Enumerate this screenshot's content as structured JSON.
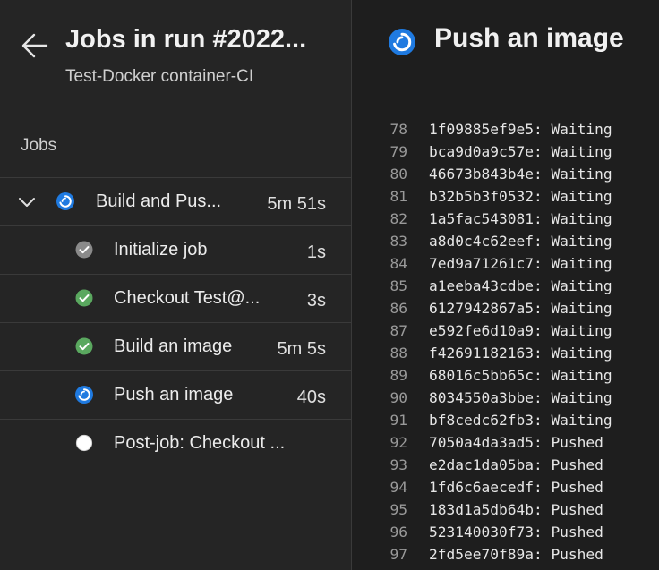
{
  "header": {
    "title": "Jobs in run #2022...",
    "subtitle": "Test-Docker container-CI"
  },
  "sidebar": {
    "section_label": "Jobs",
    "jobs": [
      {
        "name": "Build and Pus...",
        "duration": "5m 51s",
        "status": "running",
        "level": "parent"
      },
      {
        "name": "Initialize job",
        "duration": "1s",
        "status": "succeeded-gray",
        "level": "child"
      },
      {
        "name": "Checkout Test@...",
        "duration": "3s",
        "status": "succeeded",
        "level": "child"
      },
      {
        "name": "Build an image",
        "duration": "5m 5s",
        "status": "succeeded",
        "level": "child"
      },
      {
        "name": "Push an image",
        "duration": "40s",
        "status": "running",
        "level": "child"
      },
      {
        "name": "Post-job: Checkout ...",
        "duration": "",
        "status": "pending",
        "level": "child"
      }
    ]
  },
  "detail": {
    "title": "Push an image",
    "status": "running",
    "log": [
      {
        "no": "78",
        "text": "1f09885ef9e5: Waiting"
      },
      {
        "no": "79",
        "text": "bca9d0a9c57e: Waiting"
      },
      {
        "no": "80",
        "text": "46673b843b4e: Waiting"
      },
      {
        "no": "81",
        "text": "b32b5b3f0532: Waiting"
      },
      {
        "no": "82",
        "text": "1a5fac543081: Waiting"
      },
      {
        "no": "83",
        "text": "a8d0c4c62eef: Waiting"
      },
      {
        "no": "84",
        "text": "7ed9a71261c7: Waiting"
      },
      {
        "no": "85",
        "text": "a1eeba43cdbe: Waiting"
      },
      {
        "no": "86",
        "text": "6127942867a5: Waiting"
      },
      {
        "no": "87",
        "text": "e592fe6d10a9: Waiting"
      },
      {
        "no": "88",
        "text": "f42691182163: Waiting"
      },
      {
        "no": "89",
        "text": "68016c5bb65c: Waiting"
      },
      {
        "no": "90",
        "text": "8034550a3bbe: Waiting"
      },
      {
        "no": "91",
        "text": "bf8cedc62fb3: Waiting"
      },
      {
        "no": "92",
        "text": "7050a4da3ad5: Pushed"
      },
      {
        "no": "93",
        "text": "e2dac1da05ba: Pushed"
      },
      {
        "no": "94",
        "text": "1fd6c6aecedf: Pushed"
      },
      {
        "no": "95",
        "text": "183d1a5db64b: Pushed"
      },
      {
        "no": "96",
        "text": "523140030f73: Pushed"
      },
      {
        "no": "97",
        "text": "2fd5ee70f89a: Pushed"
      }
    ]
  },
  "colors": {
    "running": "#1f7ae0",
    "succeeded": "#5aa85f",
    "succeeded-gray": "#8a8a8a",
    "pending": "#ffffff"
  },
  "icons": {
    "back": "arrow-left-icon",
    "expand": "chevron-down-icon",
    "running": "running-status-icon",
    "succeeded": "check-circle-icon",
    "pending": "empty-circle-icon"
  }
}
